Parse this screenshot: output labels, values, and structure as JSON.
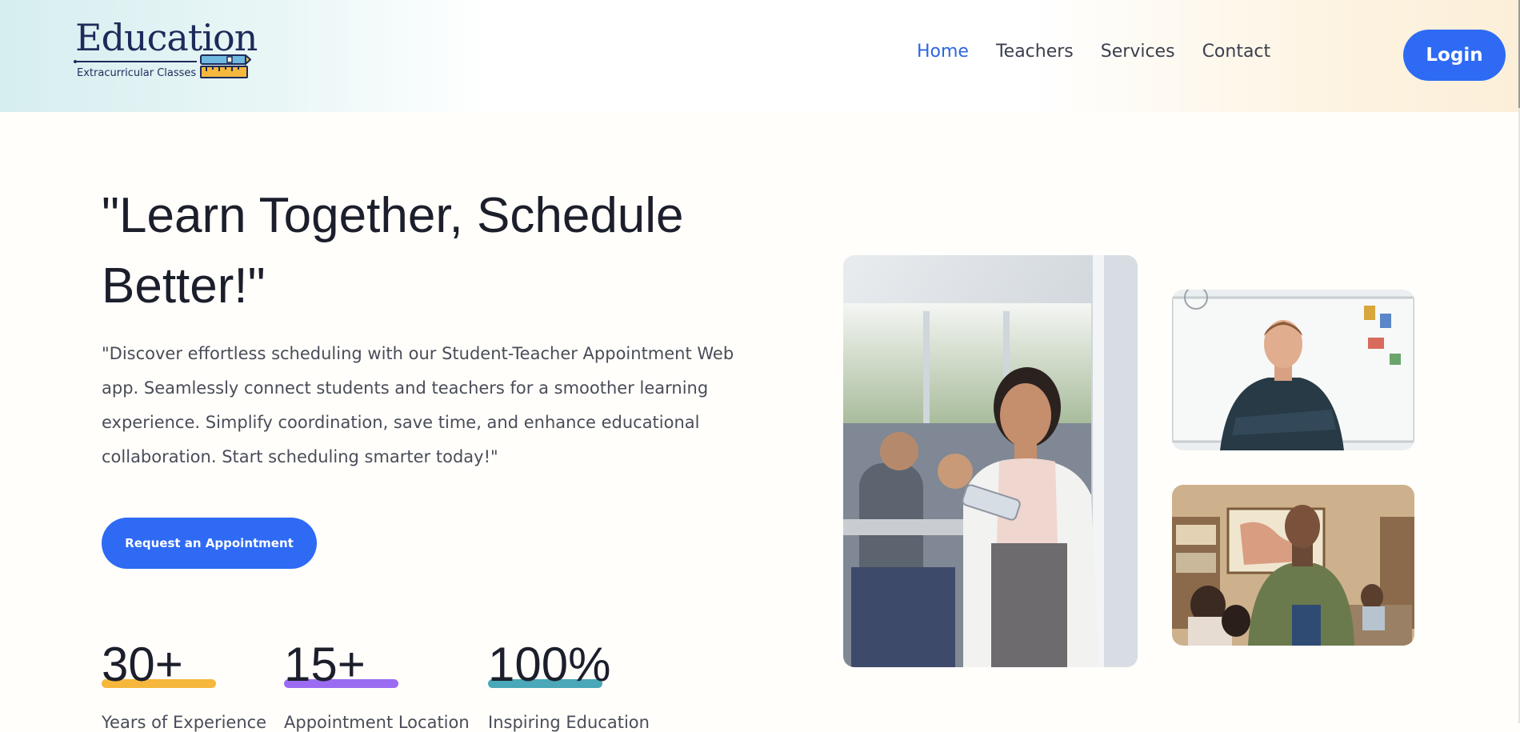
{
  "brand": {
    "name": "Education",
    "tagline": "Extracurricular Classes"
  },
  "nav": {
    "items": [
      {
        "label": "Home",
        "active": true
      },
      {
        "label": "Teachers",
        "active": false
      },
      {
        "label": "Services",
        "active": false
      },
      {
        "label": "Contact",
        "active": false
      }
    ],
    "login_label": "Login"
  },
  "hero": {
    "title": "\"Learn Together, Schedule Better!\"",
    "description": "\"Discover effortless scheduling with our Student-Teacher Appointment Web app. Seamlessly connect students and teachers for a smoother learning experience. Simplify coordination, save time, and enhance educational collaboration. Start scheduling smarter today!\"",
    "cta_label": "Request an Appointment"
  },
  "stats": [
    {
      "value": "30+",
      "label": "Years of Experience",
      "color": "#f5b83d"
    },
    {
      "value": "15+",
      "label": "Appointment Location",
      "color": "#9b6cf2"
    },
    {
      "value": "100%",
      "label": "Inspiring Education",
      "color": "#4aa8b8"
    }
  ],
  "colors": {
    "primary": "#2e6af4",
    "nav_active": "#2f66e0",
    "heading": "#1c1f2b",
    "body_text": "#4a4d58"
  },
  "images": [
    {
      "name": "teacher-woman-with-tablet-photo"
    },
    {
      "name": "teacher-man-whiteboard-photo"
    },
    {
      "name": "teacher-man-classroom-photo"
    }
  ]
}
